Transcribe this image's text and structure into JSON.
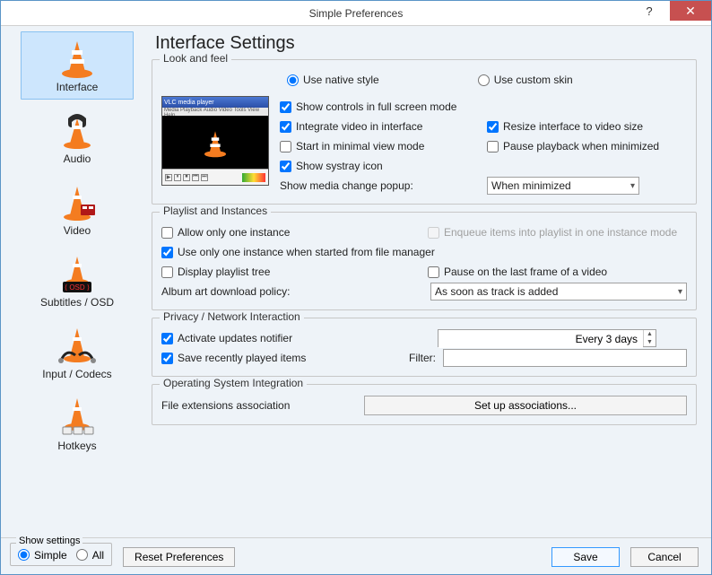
{
  "window": {
    "title": "Simple Preferences",
    "help": "?",
    "close": "✕"
  },
  "sidebar": {
    "items": [
      {
        "label": "Interface"
      },
      {
        "label": "Audio"
      },
      {
        "label": "Video"
      },
      {
        "label": "Subtitles / OSD"
      },
      {
        "label": "Input / Codecs"
      },
      {
        "label": "Hotkeys"
      }
    ]
  },
  "page": {
    "title": "Interface Settings"
  },
  "look": {
    "legend": "Look and feel",
    "native": "Use native style",
    "custom": "Use custom skin",
    "show_controls": "Show controls in full screen mode",
    "integrate": "Integrate video in interface",
    "resize": "Resize interface to video size",
    "minimal": "Start in minimal view mode",
    "pause_min": "Pause playback when minimized",
    "systray": "Show systray icon",
    "popup_label": "Show media change popup:",
    "popup_value": "When minimized"
  },
  "playlist": {
    "legend": "Playlist and Instances",
    "one_instance": "Allow only one instance",
    "enqueue": "Enqueue items into playlist in one instance mode",
    "file_manager": "Use only one instance when started from file manager",
    "tree": "Display playlist tree",
    "pause_last": "Pause on the last frame of a video",
    "album_label": "Album art download policy:",
    "album_value": "As soon as track is added"
  },
  "privacy": {
    "legend": "Privacy / Network Interaction",
    "updates": "Activate updates notifier",
    "updates_value": "Every 3 days",
    "save_recent": "Save recently played items",
    "filter_label": "Filter:",
    "filter_value": ""
  },
  "osint": {
    "legend": "Operating System Integration",
    "ext_label": "File extensions association",
    "setup_btn": "Set up associations..."
  },
  "bottom": {
    "show_settings": "Show settings",
    "simple": "Simple",
    "all": "All",
    "reset": "Reset Preferences",
    "save": "Save",
    "cancel": "Cancel"
  },
  "thumb": {
    "title": "VLC media player",
    "menu": "Media Playback Audio Video Tools View Help"
  }
}
